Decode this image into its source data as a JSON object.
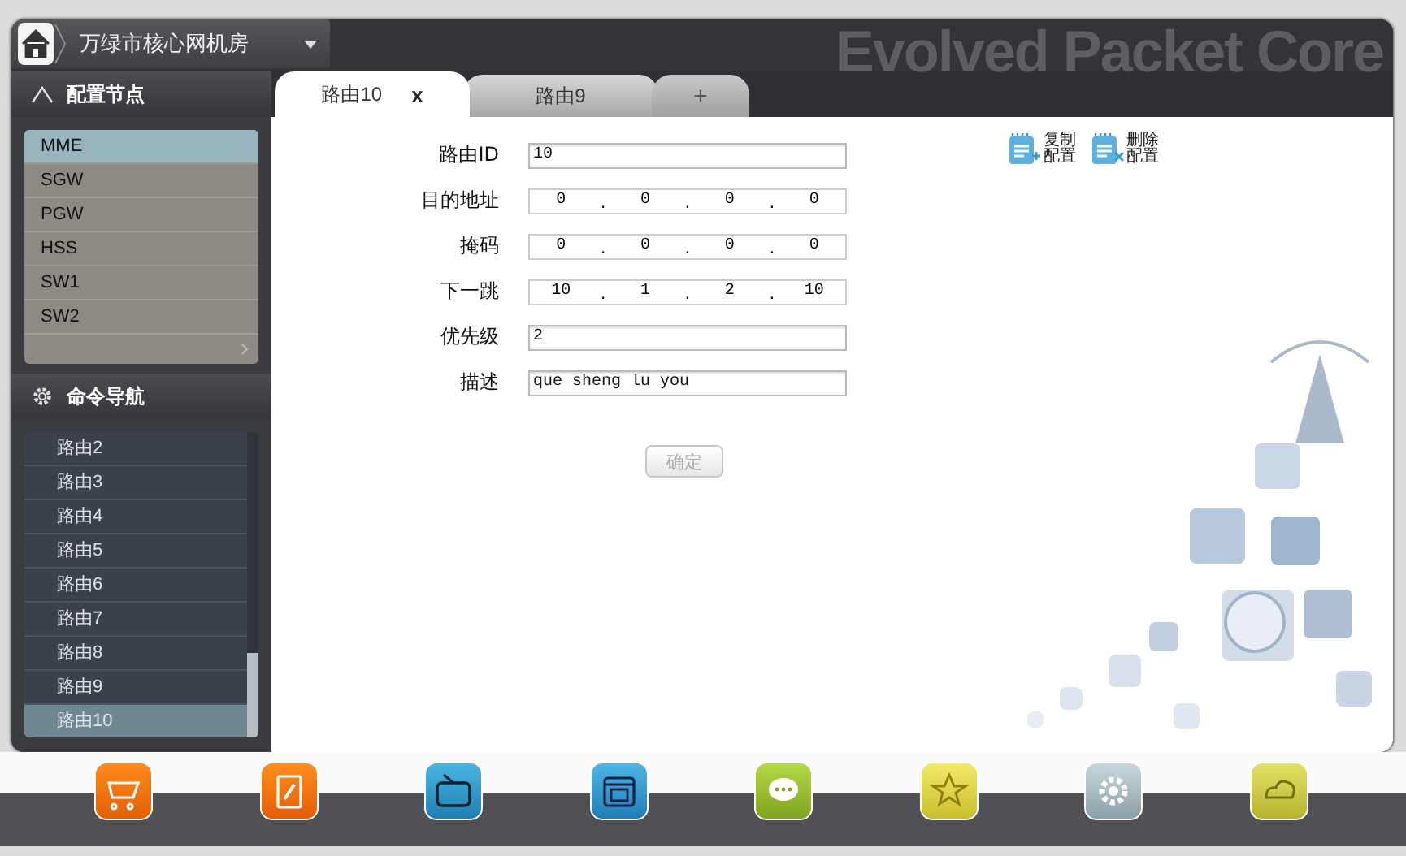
{
  "location": {
    "title": "万绿市核心网机房"
  },
  "banner": "Evolved Packet Core",
  "sidebar": {
    "config_nodes": {
      "title": "配置节点",
      "items": [
        {
          "label": "MME",
          "selected": true
        },
        {
          "label": "SGW",
          "selected": false
        },
        {
          "label": "PGW",
          "selected": false
        },
        {
          "label": "HSS",
          "selected": false
        },
        {
          "label": "SW1",
          "selected": false
        },
        {
          "label": "SW2",
          "selected": false
        }
      ]
    },
    "command_nav": {
      "title": "命令导航",
      "items": [
        {
          "label": "路由2",
          "selected": false
        },
        {
          "label": "路由3",
          "selected": false
        },
        {
          "label": "路由4",
          "selected": false
        },
        {
          "label": "路由5",
          "selected": false
        },
        {
          "label": "路由6",
          "selected": false
        },
        {
          "label": "路由7",
          "selected": false
        },
        {
          "label": "路由8",
          "selected": false
        },
        {
          "label": "路由9",
          "selected": false
        },
        {
          "label": "路由10",
          "selected": true
        }
      ]
    }
  },
  "tabs": [
    {
      "label": "路由10",
      "selected": true,
      "close": "x"
    },
    {
      "label": "路由9",
      "selected": false
    }
  ],
  "add_tab": "+",
  "actions": [
    {
      "kind": "copy",
      "label": "复制配置"
    },
    {
      "kind": "delete",
      "label": "删除配置"
    }
  ],
  "form": {
    "separator": ".",
    "fields": [
      {
        "kind": "text",
        "label": "路由ID",
        "value": "10"
      },
      {
        "kind": "ip",
        "label": "目的地址",
        "octets": [
          "0",
          "0",
          "0",
          "0"
        ]
      },
      {
        "kind": "ip",
        "label": "掩码",
        "octets": [
          "0",
          "0",
          "0",
          "0"
        ]
      },
      {
        "kind": "ip",
        "label": "下一跳",
        "octets": [
          "10",
          "1",
          "2",
          "10"
        ]
      },
      {
        "kind": "text",
        "label": "优先级",
        "value": "2"
      },
      {
        "kind": "text",
        "label": "描述",
        "value": "que sheng lu you"
      }
    ],
    "submit": {
      "label": "确定",
      "disabled": true
    }
  }
}
